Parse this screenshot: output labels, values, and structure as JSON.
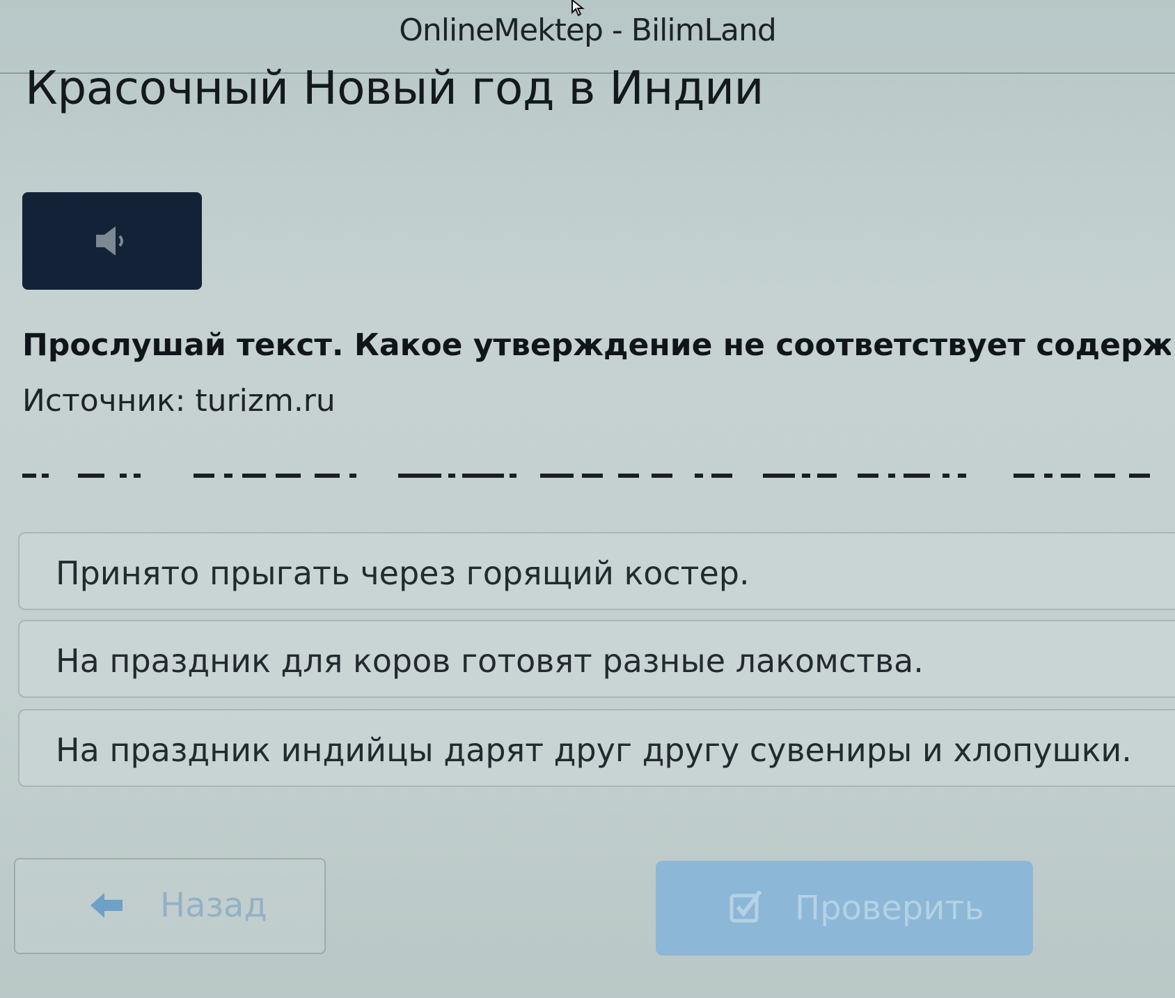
{
  "window": {
    "app_title": "OnlineMektep - BilimLand"
  },
  "lesson": {
    "title": "Красочный Новый год в Индии",
    "question": "Прослушай текст. Какое утверждение не соответствует содержанию",
    "source": "Источник: turizm.ru"
  },
  "options": [
    {
      "label": "Принято прыгать через горящий костер."
    },
    {
      "label": "На праздник для коров готовят разные лакомства."
    },
    {
      "label": "На праздник индийцы дарят друг другу сувениры и хлопушки."
    }
  ],
  "footer": {
    "back_label": "Назад",
    "check_label": "Проверить"
  },
  "colors": {
    "audio_button": "#132236",
    "check_button": "#8db7d6",
    "back_arrow": "#6fa0c6"
  },
  "icons": {
    "audio": "speaker-icon",
    "back": "arrow-left-icon",
    "check": "checkbox-check-icon"
  }
}
